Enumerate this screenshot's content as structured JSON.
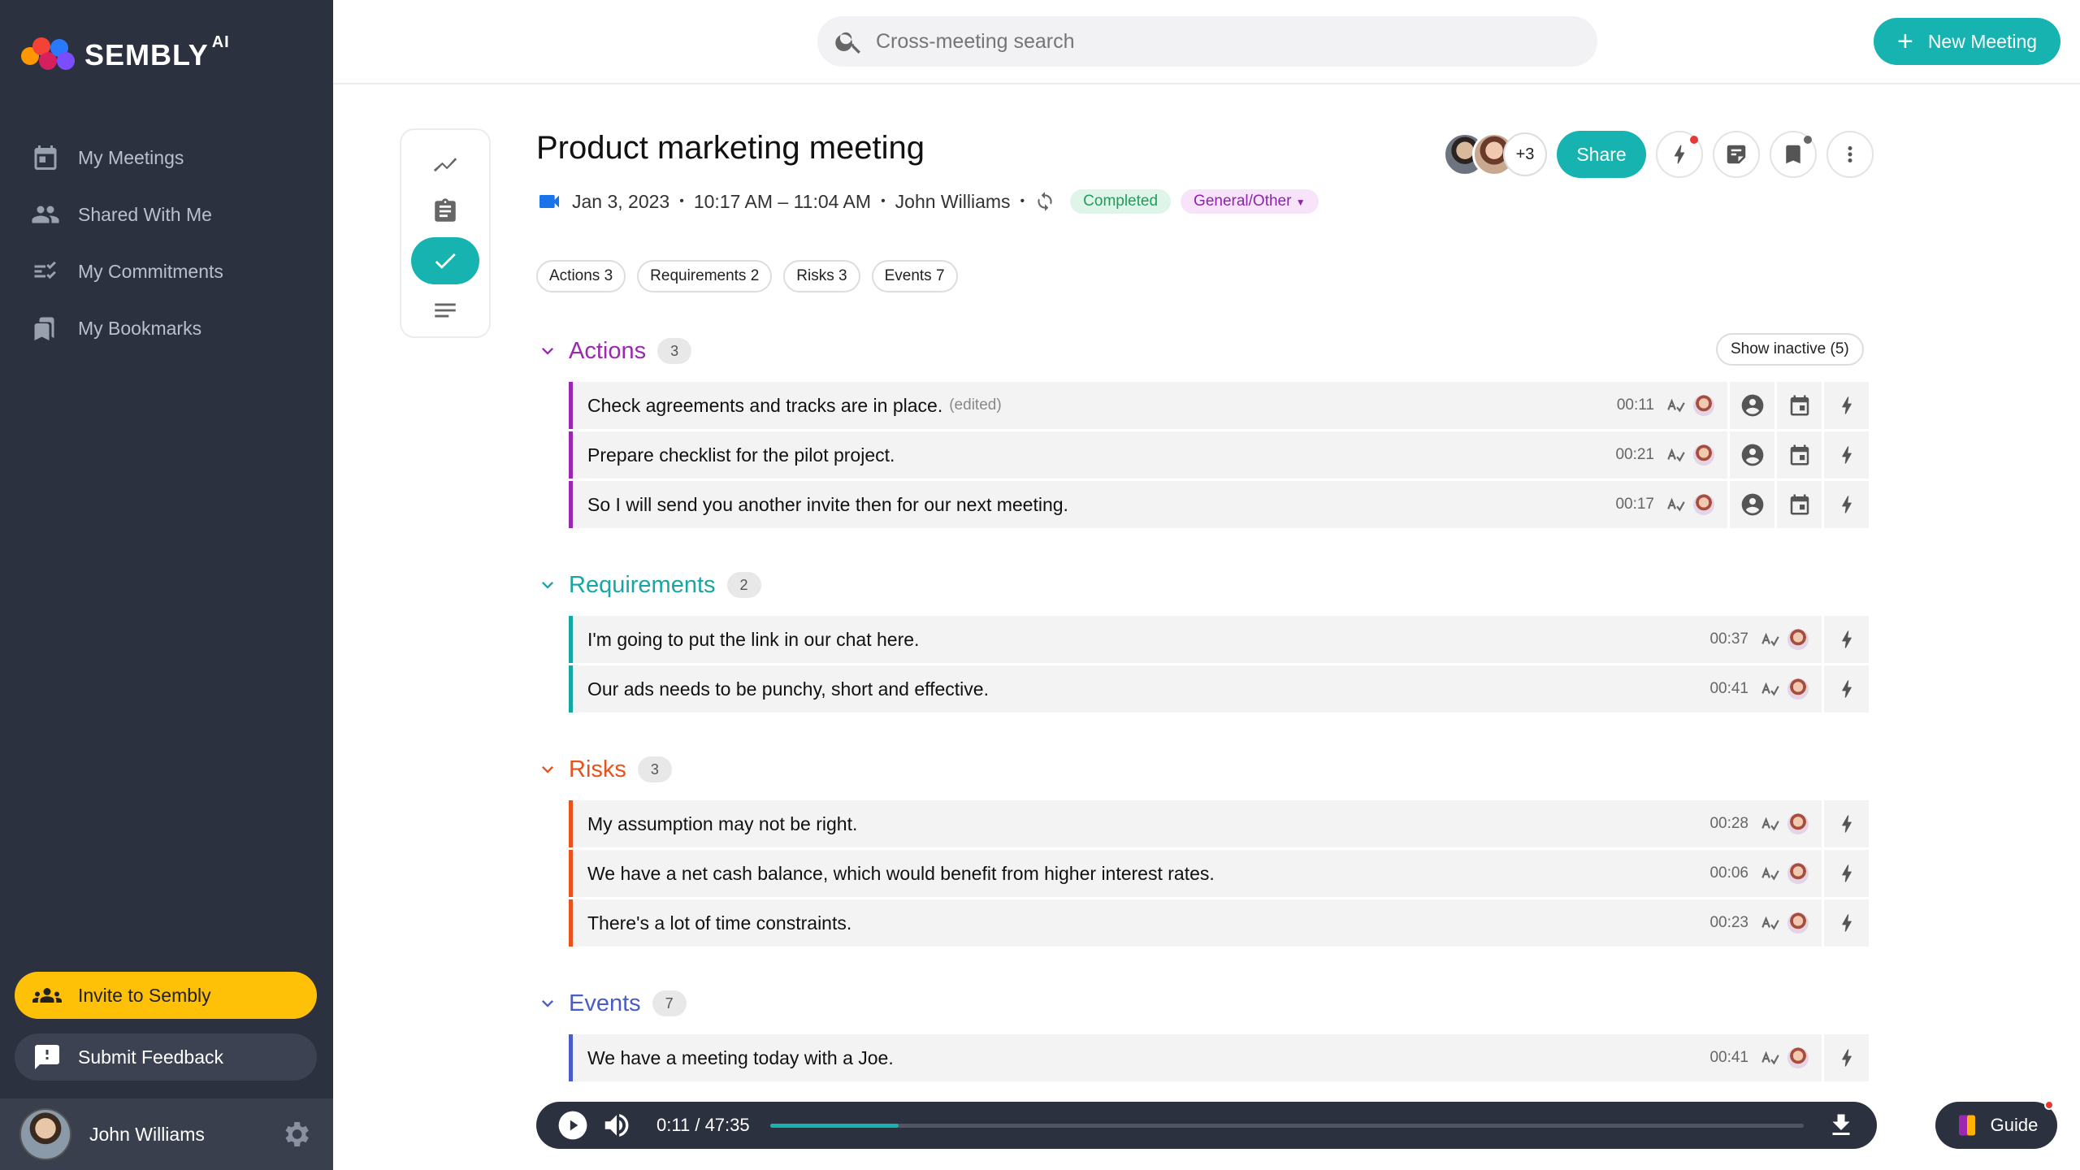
{
  "app": {
    "name": "SEMBLY",
    "name_sup": "AI"
  },
  "sidebar": {
    "items": [
      {
        "label": "My Meetings",
        "icon": "calendar-icon"
      },
      {
        "label": "Shared With Me",
        "icon": "people-icon"
      },
      {
        "label": "My Commitments",
        "icon": "checklist-icon"
      },
      {
        "label": "My Bookmarks",
        "icon": "bookmarks-icon"
      }
    ],
    "invite_label": "Invite to Sembly",
    "feedback_label": "Submit Feedback",
    "user_name": "John Williams"
  },
  "topbar": {
    "search_placeholder": "Cross-meeting search",
    "new_meeting_label": "New Meeting"
  },
  "meeting": {
    "title": "Product marketing meeting",
    "date": "Jan 3, 2023",
    "time": "10:17 AM – 11:04 AM",
    "owner": "John Williams",
    "status": "Completed",
    "category": "General/Other",
    "extra_participants": "+3",
    "share_label": "Share"
  },
  "chips": [
    "Actions 3",
    "Requirements 2",
    "Risks 3",
    "Events 7"
  ],
  "sections": {
    "actions": {
      "title": "Actions",
      "count": "3",
      "color": "#9c27b0",
      "show_inactive": "Show inactive (5)",
      "rows": [
        {
          "text": "Check agreements and tracks are in place.",
          "edited": "(edited)",
          "ts": "00:11"
        },
        {
          "text": "Prepare checklist for the pilot project.",
          "ts": "00:21"
        },
        {
          "text": "So I will send you another invite then for our next meeting.",
          "ts": "00:17"
        }
      ]
    },
    "requirements": {
      "title": "Requirements",
      "count": "2",
      "color": "#16a6a3",
      "rows": [
        {
          "text": "I'm going to put the link in our chat here.",
          "ts": "00:37"
        },
        {
          "text": "Our ads needs to be punchy, short and effective.",
          "ts": "00:41"
        }
      ]
    },
    "risks": {
      "title": "Risks",
      "count": "3",
      "color": "#e8521c",
      "rows": [
        {
          "text": "My assumption may not be right.",
          "ts": "00:28"
        },
        {
          "text": "We have a net cash balance, which would benefit from higher interest rates.",
          "ts": "00:06"
        },
        {
          "text": "There's a lot of time constraints.",
          "ts": "00:23"
        }
      ]
    },
    "events": {
      "title": "Events",
      "count": "7",
      "color": "#4a5cc7",
      "rows": [
        {
          "text": "We have a meeting today with a Joe.",
          "ts": "00:41"
        }
      ]
    }
  },
  "player": {
    "current": "0:11",
    "total": "47:35",
    "separator": "/",
    "progress_fraction": 0.124
  },
  "guide_label": "Guide",
  "colors": {
    "accent": "#16b3b0",
    "sidebar": "#2c3140",
    "invite": "#ffc107"
  }
}
